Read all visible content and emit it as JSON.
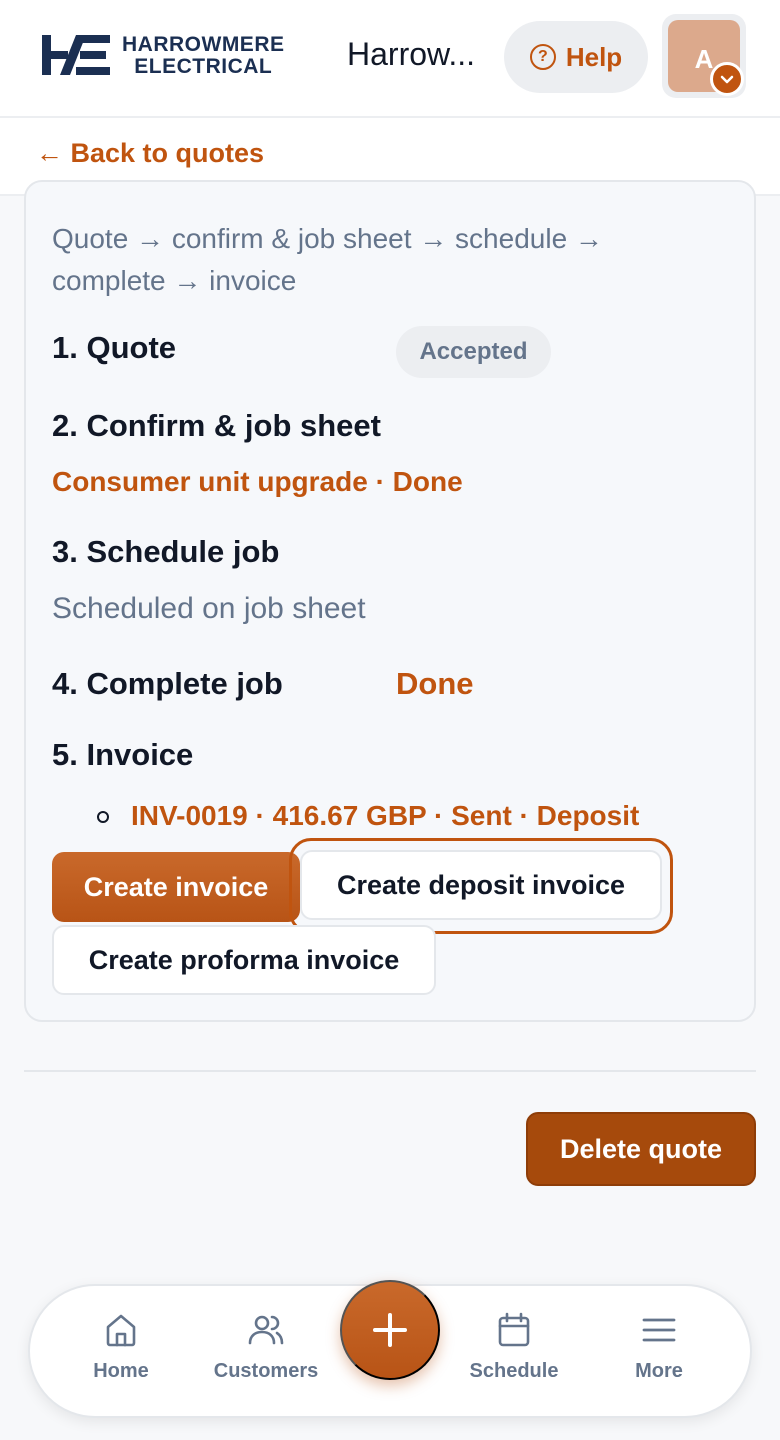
{
  "header": {
    "logo_line1": "HARROWMERE",
    "logo_line2": "ELECTRICAL",
    "app_title": "Harrow...",
    "help_label": "Help",
    "avatar_initial": "A"
  },
  "back_link": "← Back to quotes",
  "workflow": {
    "flow_text": "Quote → confirm & job sheet → schedule → complete → invoice",
    "step1": {
      "title": "1. Quote",
      "badge": "Accepted"
    },
    "step2": {
      "title": "2. Confirm & job sheet",
      "link": "Consumer unit upgrade · Done"
    },
    "step3": {
      "title": "3. Schedule job",
      "status": "Scheduled on job sheet"
    },
    "step4": {
      "title": "4. Complete job",
      "status": "Done"
    },
    "step5": {
      "title": "5. Invoice",
      "invoices": [
        "INV-0019 · 416.67 GBP · Sent · Deposit"
      ]
    },
    "buttons": {
      "create_invoice": "Create invoice",
      "create_deposit_invoice": "Create deposit invoice",
      "create_proforma_invoice": "Create proforma invoice"
    }
  },
  "delete_quote": "Delete quote",
  "bottom_nav": {
    "home": "Home",
    "customers": "Customers",
    "add": "+",
    "schedule": "Schedule",
    "more": "More"
  },
  "colors": {
    "accent": "#c0540f",
    "brand_navy": "#1b2f52",
    "muted": "#64748b",
    "danger_button": "#a64a0c"
  },
  "icons": [
    "help-icon",
    "chevron-down-icon",
    "home-icon",
    "users-icon",
    "plus-icon",
    "calendar-icon",
    "menu-icon"
  ]
}
